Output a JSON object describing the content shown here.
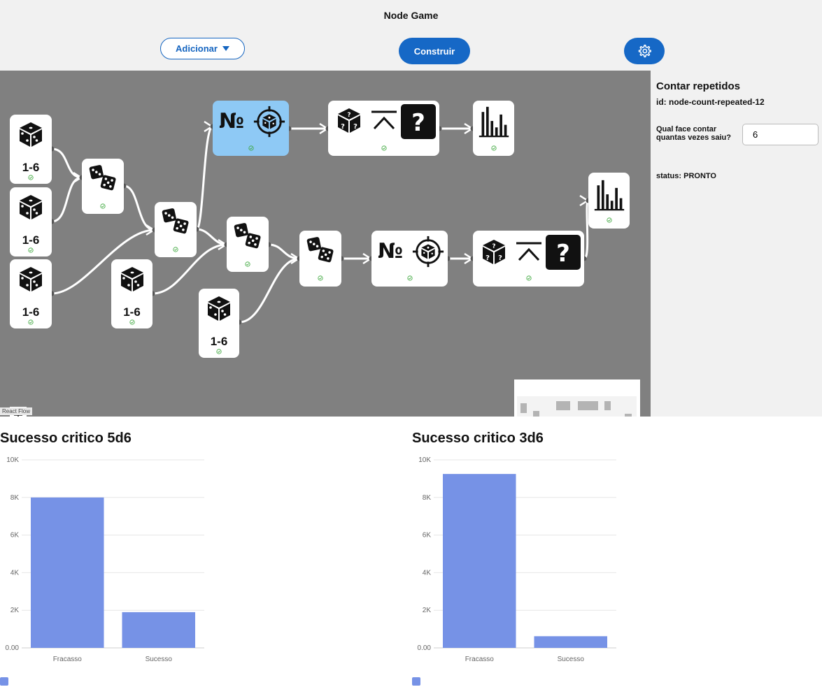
{
  "header": {
    "title": "Node Game",
    "add_label": "Adicionar",
    "build_label": "Construir"
  },
  "canvas": {
    "range_label": "1-6",
    "attribution": "React Flow"
  },
  "panel": {
    "title": "Contar repetidos",
    "id_text": "id: node-count-repeated-12",
    "face_label": "Qual face contar quantas vezes saiu?",
    "face_value": "6",
    "status_text": "status: PRONTO"
  },
  "colors": {
    "accent": "#1668c6",
    "bar": "#7692e6",
    "canvas_bg": "#808080",
    "selected_node": "#8ec9f5",
    "ok_check": "#3aa63a"
  },
  "chart_data": [
    {
      "type": "bar",
      "title": "Sucesso critico 5d6",
      "categories": [
        "Fracasso",
        "Sucesso"
      ],
      "values": [
        8000,
        1900
      ],
      "ylim": [
        0,
        10000
      ],
      "yticks": [
        "0.00",
        "2K",
        "4K",
        "6K",
        "8K",
        "10K"
      ],
      "grid": true,
      "legend": "bottom-left"
    },
    {
      "type": "bar",
      "title": "Sucesso critico 3d6",
      "categories": [
        "Fracasso",
        "Sucesso"
      ],
      "values": [
        9250,
        620
      ],
      "ylim": [
        0,
        10000
      ],
      "yticks": [
        "0.00",
        "2K",
        "4K",
        "6K",
        "8K",
        "10K"
      ],
      "grid": true,
      "legend": "bottom-left"
    }
  ]
}
